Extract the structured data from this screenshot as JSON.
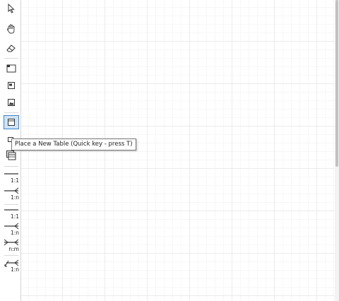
{
  "toolbar": {
    "tools": [
      {
        "icon": "pointer-icon",
        "label": "Select"
      },
      {
        "icon": "hand-icon",
        "label": "Pan"
      },
      {
        "icon": "eraser-icon",
        "label": "Erase"
      },
      {
        "icon": "view-icon",
        "label": "View"
      },
      {
        "icon": "note-icon",
        "label": "Note"
      },
      {
        "icon": "image-icon",
        "label": "Image"
      },
      {
        "icon": "table-icon",
        "label": "New Table",
        "active": true
      },
      {
        "icon": "copy-table-icon",
        "label": "Table copy"
      }
    ],
    "relationships": [
      {
        "icon": "relationship-1-1-icon",
        "label": "1:1"
      },
      {
        "icon": "relationship-1-n-icon",
        "label": "1:n"
      },
      {
        "icon": "relationship-1-1-icon",
        "label": "1:1"
      },
      {
        "icon": "relationship-1-n-icon",
        "label": "1:n"
      },
      {
        "icon": "relationship-n-m-icon",
        "label": "n:m"
      },
      {
        "icon": "relationship-1-n-icon",
        "label": "1:n"
      }
    ]
  },
  "tooltip": {
    "text": "Place a New Table (Quick key - press T)"
  },
  "colors": {
    "active_bg": "#cfe3f5",
    "active_border": "#3d86cc",
    "grid": "#ebebeb"
  }
}
